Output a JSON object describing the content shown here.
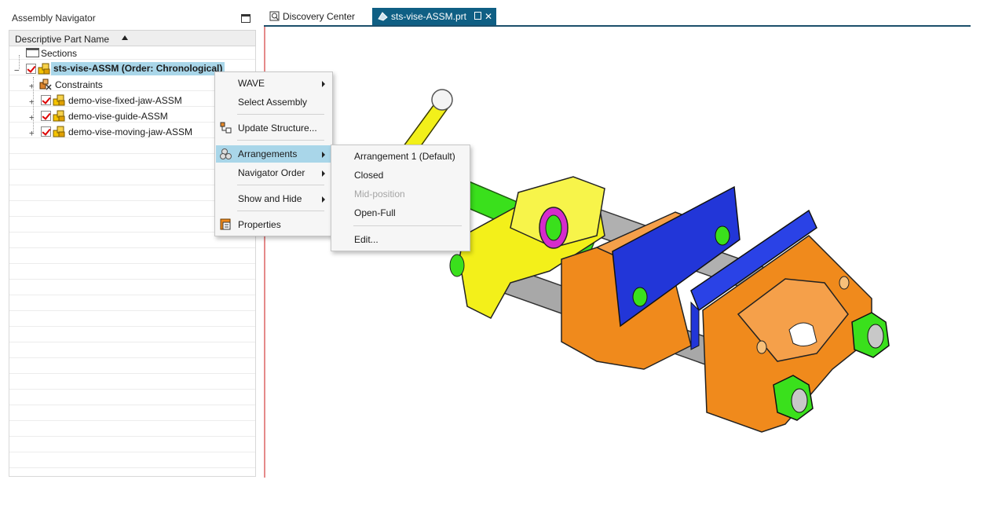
{
  "navigator": {
    "title": "Assembly Navigator",
    "column_header": "Descriptive Part Name",
    "tree": {
      "sections": "Sections",
      "root": "sts-vise-ASSM (Order: Chronological)",
      "children": [
        "Constraints",
        "demo-vise-fixed-jaw-ASSM",
        "demo-vise-guide-ASSM",
        "demo-vise-moving-jaw-ASSM"
      ]
    }
  },
  "tabs": [
    {
      "label": "Discovery Center"
    },
    {
      "label": "sts-vise-ASSM.prt",
      "close": "✕"
    }
  ],
  "context_menu": {
    "items": [
      "WAVE",
      "Select Assembly",
      "Update Structure...",
      "Arrangements",
      "Navigator Order",
      "Show and Hide",
      "Properties"
    ]
  },
  "arrangements_menu": {
    "items": [
      "Arrangement 1 (Default)",
      "Closed",
      "Mid-position",
      "Open-Full",
      "Edit..."
    ]
  },
  "colors": {
    "accent_tab": "#0f5f84",
    "highlight": "#a9d6e9",
    "vise_body": "#f08a1c",
    "jaw_plate": "#2236d8",
    "bolt": "#3adf1a",
    "handle": "#f2f01a"
  }
}
